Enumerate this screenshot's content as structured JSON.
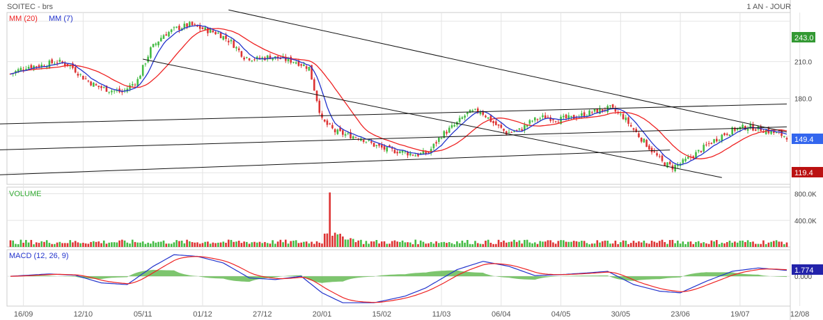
{
  "header": {
    "title": "SOITEC - brs",
    "period": "1 AN - JOUR"
  },
  "colors": {
    "up": "#44bb44",
    "down": "#dd3333",
    "ma20": "#ee2222",
    "ma7": "#2233cc",
    "trend": "#111111",
    "grid": "#e4e4e4",
    "tag_high": "#339933",
    "tag_last": "#3366ee",
    "tag_low": "#bb1111",
    "tag_macd": "#2222aa",
    "hist": "#66bb55"
  },
  "chart_data": [
    {
      "type": "candlestick",
      "legend": [
        {
          "label": "MM (20)",
          "color": "#ee2222"
        },
        {
          "label": "MM (7)",
          "color": "#2233cc"
        }
      ],
      "ylim": [
        110,
        250
      ],
      "yticks": [
        210.0,
        180.0
      ],
      "ytick_labels": [
        "210.0",
        "180.0"
      ],
      "tags": {
        "high": "243.0",
        "last": "149.4",
        "low": "119.4"
      },
      "x_dates": [
        "16/09",
        "12/10",
        "05/11",
        "01/12",
        "27/12",
        "20/01",
        "15/02",
        "11/03",
        "06/04",
        "04/05",
        "30/05",
        "23/06",
        "19/07",
        "12/08"
      ],
      "series_anchors": [
        [
          0,
          200
        ],
        [
          6,
          206
        ],
        [
          12,
          207
        ],
        [
          18,
          210
        ],
        [
          23,
          207
        ],
        [
          28,
          197
        ],
        [
          33,
          190
        ],
        [
          38,
          187
        ],
        [
          43,
          185
        ],
        [
          49,
          195
        ],
        [
          54,
          220
        ],
        [
          59,
          232
        ],
        [
          64,
          237
        ],
        [
          69,
          240
        ],
        [
          75,
          236
        ],
        [
          80,
          233
        ],
        [
          85,
          226
        ],
        [
          90,
          214
        ],
        [
          95,
          212
        ],
        [
          100,
          214
        ],
        [
          105,
          212
        ],
        [
          110,
          210
        ],
        [
          115,
          205
        ],
        [
          120,
          162
        ],
        [
          125,
          153
        ],
        [
          130,
          150
        ],
        [
          135,
          148
        ],
        [
          140,
          142
        ],
        [
          145,
          138
        ],
        [
          150,
          137
        ],
        [
          156,
          134
        ],
        [
          161,
          136
        ],
        [
          166,
          150
        ],
        [
          171,
          158
        ],
        [
          176,
          168
        ],
        [
          181,
          170
        ],
        [
          186,
          160
        ],
        [
          191,
          152
        ],
        [
          196,
          154
        ],
        [
          201,
          162
        ],
        [
          206,
          165
        ],
        [
          211,
          163
        ],
        [
          216,
          164
        ],
        [
          221,
          167
        ],
        [
          226,
          170
        ],
        [
          231,
          172
        ],
        [
          236,
          165
        ],
        [
          241,
          152
        ],
        [
          246,
          140
        ],
        [
          251,
          128
        ],
        [
          255,
          124
        ],
        [
          259,
          128
        ],
        [
          264,
          135
        ],
        [
          269,
          143
        ],
        [
          274,
          150
        ],
        [
          279,
          155
        ],
        [
          284,
          157
        ],
        [
          289,
          155
        ],
        [
          294,
          152
        ],
        [
          299,
          149
        ]
      ],
      "trendlines": [
        {
          "start": [
            -8,
            159.0
          ],
          "end": [
            299,
            175.5
          ]
        },
        {
          "start": [
            -8,
            137.9
          ],
          "end": [
            299,
            156.8
          ]
        },
        {
          "start": [
            -8,
            117.5
          ],
          "end": [
            254,
            138.0
          ]
        },
        {
          "start": [
            84,
            252.1
          ],
          "end": [
            299,
            152.6
          ]
        },
        {
          "start": [
            51,
            212.0
          ],
          "end": [
            274,
            115.5
          ]
        }
      ]
    },
    {
      "type": "bar",
      "title": "VOLUME",
      "ylim": [
        0,
        900
      ],
      "yticks": [
        800,
        400
      ],
      "ytick_labels": [
        "800.0K",
        "400.0K"
      ],
      "spike": {
        "index": 123,
        "value": 820
      }
    },
    {
      "type": "line",
      "title": "MACD (12, 26, 9)",
      "ylim": [
        -9,
        8
      ],
      "ytick_labels": [
        "0.000"
      ],
      "tag": "1.774",
      "macd_anchors": [
        [
          0,
          0
        ],
        [
          15,
          0.7
        ],
        [
          25,
          0.3
        ],
        [
          35,
          -2.0
        ],
        [
          45,
          -2.5
        ],
        [
          55,
          3.0
        ],
        [
          63,
          6.5
        ],
        [
          72,
          6.0
        ],
        [
          82,
          4.0
        ],
        [
          92,
          -0.5
        ],
        [
          102,
          -1.0
        ],
        [
          112,
          0.0
        ],
        [
          120,
          -5.0
        ],
        [
          128,
          -8.0
        ],
        [
          140,
          -8.0
        ],
        [
          152,
          -6.0
        ],
        [
          160,
          -3.5
        ],
        [
          172,
          2.0
        ],
        [
          182,
          4.5
        ],
        [
          192,
          3.0
        ],
        [
          202,
          0.2
        ],
        [
          212,
          0.5
        ],
        [
          222,
          1.0
        ],
        [
          230,
          1.5
        ],
        [
          240,
          -2.5
        ],
        [
          250,
          -4.5
        ],
        [
          258,
          -5.0
        ],
        [
          268,
          -1.5
        ],
        [
          278,
          1.5
        ],
        [
          288,
          2.5
        ],
        [
          299,
          1.774
        ]
      ]
    }
  ]
}
